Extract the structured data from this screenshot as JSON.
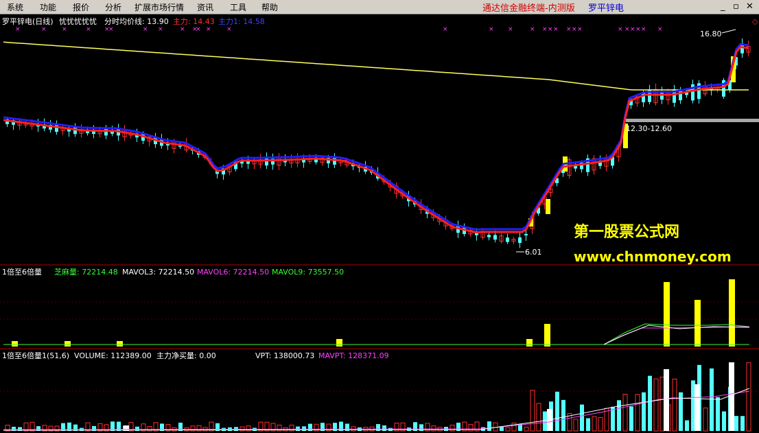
{
  "menu": {
    "items": [
      "系统",
      "功能",
      "报价",
      "分析",
      "扩展市场行情",
      "资讯",
      "工具",
      "帮助"
    ],
    "app_title": "通达信金融终端-内测版",
    "stock_title": "罗平锌电"
  },
  "price_panel": {
    "header": {
      "name": "罗平锌电(日线)",
      "indicator": "忧忧忧忧忧",
      "avg_label": "分时均价线: 13.90",
      "main_label": "主力: 14.43",
      "main1_label": "主力1: 14.58"
    },
    "high_label": "16.80",
    "low_label": "6.01",
    "band_label": "12.30-12.60",
    "colors": {
      "up": "#ff3030",
      "down": "#54ffff",
      "main": "#ff2020",
      "main1": "#2020ff",
      "avg": "#ffff60",
      "marker": "#ff40ff"
    }
  },
  "vol_panel": {
    "header": {
      "name": "1倍至6倍量",
      "l1": "芝麻量: 72214.48",
      "l2": "MAVOL3: 72214.50",
      "l3": "MAVOL6: 72214.50",
      "l4": "MAVOL9: 73557.50"
    },
    "colors": {
      "l1": "#33ff33",
      "l2": "#ffffff",
      "l3": "#ff40ff",
      "l4": "#33ff33"
    }
  },
  "bottom_panel": {
    "header": {
      "name": "1倍至6倍量1(51,6)",
      "l1": "VOLUME: 112389.00",
      "l2": "主力净买量: 0.00",
      "l3": "VPT: 138000.73",
      "l4": "MAVPT: 128371.09"
    },
    "colors": {
      "l3": "#ffffff",
      "l4": "#ff40ff"
    }
  },
  "watermark": {
    "line1": "第一股票公式网",
    "line2": "www.chnmoney.com"
  }
}
